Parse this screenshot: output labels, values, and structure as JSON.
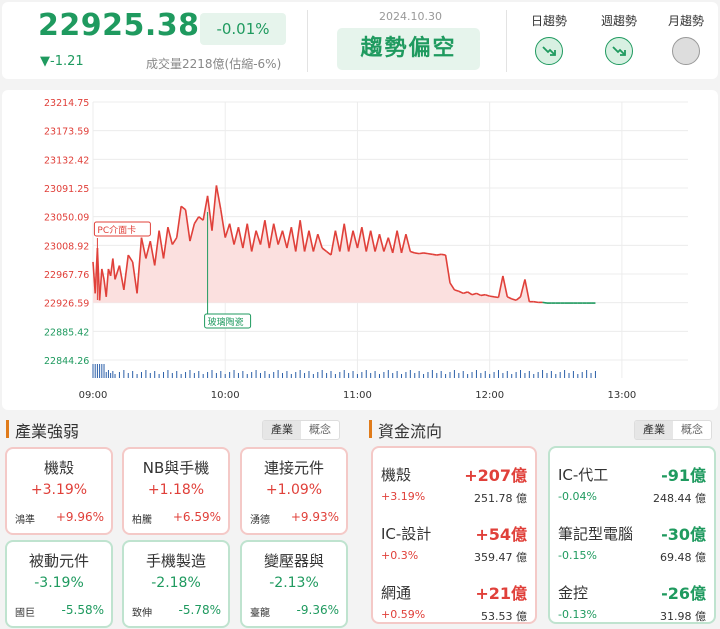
{
  "header": {
    "price": "22925.38",
    "change_pct": "-0.01%",
    "change": "▼-1.21",
    "volume": "成交量2218億(估縮-6%)",
    "date": "2024.10.30",
    "trend": "趨勢偏空",
    "trends": [
      {
        "label": "日趨勢",
        "icon": "trend-down-icon",
        "state": "down"
      },
      {
        "label": "週趨勢",
        "icon": "trend-down-icon",
        "state": "down"
      },
      {
        "label": "月趨勢",
        "icon": "trend-neutral-icon",
        "state": "neutral"
      }
    ]
  },
  "chart_data": {
    "type": "line",
    "y_ticks": [
      "23214.75",
      "23173.59",
      "23132.42",
      "23091.25",
      "23050.09",
      "23008.92",
      "22967.76",
      "22926.59",
      "22885.42",
      "22844.26"
    ],
    "x_ticks": [
      "09:00",
      "10:00",
      "11:00",
      "12:00",
      "13:00"
    ],
    "ylim": [
      22844.26,
      23214.75
    ],
    "reference": 22926.59,
    "x_start": "09:00",
    "x_end": "13:30",
    "annotations": [
      {
        "label": "PC介面卡",
        "time": "09:02",
        "color": "#e0403a"
      },
      {
        "label": "玻璃陶瓷",
        "time": "09:52",
        "color": "#1f9a5f"
      }
    ],
    "series": [
      {
        "times": [
          "09:00",
          "09:01",
          "09:02",
          "09:03",
          "09:04",
          "09:05",
          "09:06",
          "09:07",
          "09:08",
          "09:09",
          "09:10",
          "09:12",
          "09:14",
          "09:16",
          "09:18",
          "09:20",
          "09:22",
          "09:24",
          "09:26",
          "09:28",
          "09:30",
          "09:32",
          "09:34",
          "09:36",
          "09:38",
          "09:40",
          "09:42",
          "09:44",
          "09:46",
          "09:48",
          "09:50",
          "09:52",
          "09:54",
          "09:56",
          "09:58",
          "10:00",
          "10:02",
          "10:04",
          "10:06",
          "10:08",
          "10:10",
          "10:12",
          "10:14",
          "10:16",
          "10:18",
          "10:20",
          "10:22",
          "10:24",
          "10:26",
          "10:28",
          "10:30",
          "10:32",
          "10:34",
          "10:36",
          "10:38",
          "10:40",
          "10:42",
          "10:44",
          "10:46",
          "10:48",
          "10:50",
          "10:52",
          "10:54",
          "10:56",
          "10:58",
          "11:00",
          "11:02",
          "11:04",
          "11:06",
          "11:08",
          "11:10",
          "11:12",
          "11:14",
          "11:16",
          "11:18",
          "11:20",
          "11:22",
          "11:24",
          "11:26",
          "11:28",
          "11:30",
          "11:32",
          "11:34",
          "11:36",
          "11:38",
          "11:40",
          "11:42",
          "11:44",
          "11:46",
          "11:48",
          "11:50",
          "11:52",
          "11:54",
          "11:56",
          "11:58",
          "12:00",
          "12:02",
          "12:04",
          "12:06",
          "12:08",
          "12:10",
          "12:12",
          "12:14",
          "12:16",
          "12:18",
          "12:20",
          "12:22",
          "12:24",
          "12:26",
          "12:28",
          "12:30",
          "12:32",
          "12:34",
          "12:36",
          "12:38",
          "12:40",
          "12:42",
          "12:44",
          "12:46",
          "12:48"
        ],
        "values": [
          22985,
          22940,
          23005,
          22930,
          22975,
          22960,
          22935,
          22975,
          22965,
          22990,
          22960,
          22980,
          22945,
          22995,
          22985,
          22940,
          23020,
          22990,
          23015,
          22980,
          23030,
          22990,
          23035,
          23010,
          23020,
          23065,
          23060,
          23015,
          23040,
          23050,
          23045,
          23080,
          23030,
          23095,
          23060,
          23020,
          23040,
          23010,
          23035,
          23005,
          23040,
          23000,
          23030,
          23010,
          23045,
          23005,
          23040,
          23010,
          23030,
          23005,
          23035,
          23000,
          23045,
          23000,
          23030,
          23000,
          23025,
          23005,
          23000,
          22995,
          23030,
          23000,
          23040,
          23000,
          23030,
          23005,
          23035,
          23000,
          23030,
          23000,
          23025,
          23000,
          23020,
          22998,
          23030,
          22998,
          23025,
          23000,
          22998,
          22997,
          22998,
          22997,
          22996,
          22995,
          22996,
          22995,
          22955,
          22945,
          22943,
          22940,
          22942,
          22938,
          22940,
          22937,
          22938,
          22936,
          22935,
          22934,
          22965,
          22935,
          22932,
          22930,
          22935,
          22960,
          22928,
          22928,
          22927,
          22927,
          22926,
          22926,
          22926,
          22926,
          22926,
          22926,
          22926,
          22926,
          22926,
          22926,
          22926,
          22926
        ]
      }
    ]
  },
  "industry": {
    "title": "產業強弱",
    "tabs": [
      "產業",
      "概念"
    ],
    "cards": [
      {
        "name": "機殼",
        "pct": "+3.19%",
        "stock": "鴻準",
        "stock_pct": "+9.96%",
        "dir": "up"
      },
      {
        "name": "NB與手機",
        "pct": "+1.18%",
        "stock": "柏騰",
        "stock_pct": "+6.59%",
        "dir": "up"
      },
      {
        "name": "連接元件",
        "pct": "+1.09%",
        "stock": "湧德",
        "stock_pct": "+9.93%",
        "dir": "up"
      },
      {
        "name": "被動元件",
        "pct": "-3.19%",
        "stock": "國巨",
        "stock_pct": "-5.58%",
        "dir": "down"
      },
      {
        "name": "手機製造",
        "pct": "-2.18%",
        "stock": "致伸",
        "stock_pct": "-5.78%",
        "dir": "down"
      },
      {
        "name": "變壓器與",
        "pct": "-2.13%",
        "stock": "臺龍",
        "stock_pct": "-9.36%",
        "dir": "down"
      }
    ]
  },
  "money_flow": {
    "title": "資金流向",
    "tabs": [
      "產業",
      "概念"
    ],
    "inflow": [
      {
        "name": "機殼",
        "amount": "+207億",
        "pct": "+3.19%",
        "cap": "251.78 億"
      },
      {
        "name": "IC-設計",
        "amount": "+54億",
        "pct": "+0.3%",
        "cap": "359.47 億"
      },
      {
        "name": "網通",
        "amount": "+21億",
        "pct": "+0.59%",
        "cap": "53.53 億"
      }
    ],
    "outflow": [
      {
        "name": "IC-代工",
        "amount": "-91億",
        "pct": "-0.04%",
        "cap": "248.44 億"
      },
      {
        "name": "筆記型電腦",
        "amount": "-30億",
        "pct": "-0.15%",
        "cap": "69.48 億"
      },
      {
        "name": "金控",
        "amount": "-26億",
        "pct": "-0.13%",
        "cap": "31.98 億"
      }
    ]
  }
}
